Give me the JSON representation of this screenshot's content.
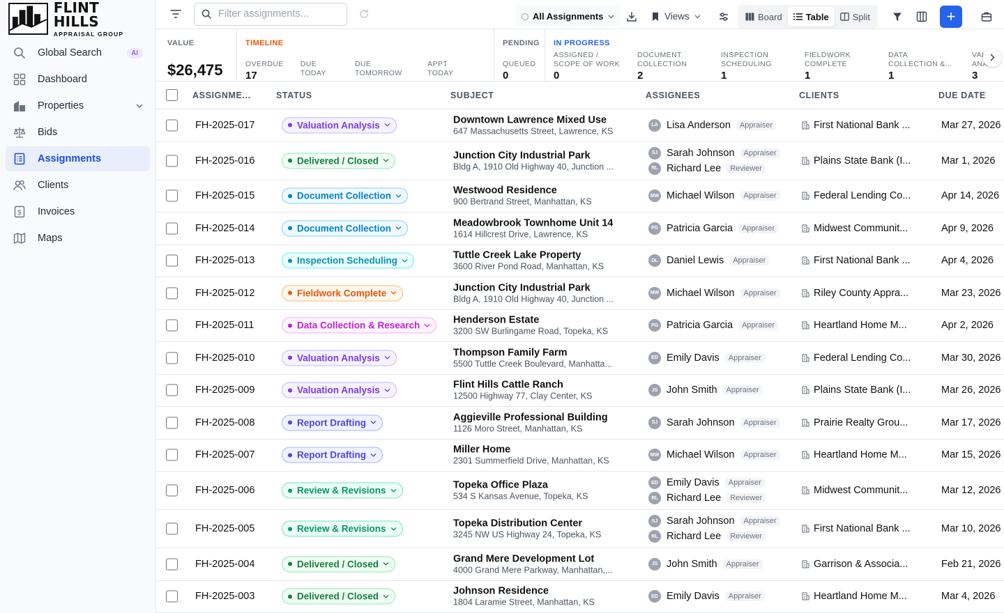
{
  "brand": {
    "line1": "FLINT HILLS",
    "line2": "APPRAISAL GROUP"
  },
  "sidebar": {
    "items": [
      {
        "label": "Global Search",
        "icon": "search-icon",
        "badge": "AI"
      },
      {
        "label": "Dashboard",
        "icon": "dashboard-icon"
      },
      {
        "label": "Properties",
        "icon": "building-icon",
        "chevron": true
      },
      {
        "label": "Bids",
        "icon": "scale-icon"
      },
      {
        "label": "Assignments",
        "icon": "clipboard-list-icon",
        "active": true
      },
      {
        "label": "Clients",
        "icon": "users-icon"
      },
      {
        "label": "Invoices",
        "icon": "invoice-icon"
      },
      {
        "label": "Maps",
        "icon": "map-icon"
      }
    ]
  },
  "toolbar": {
    "search_placeholder": "Filter assignments...",
    "filter_select": "All Assignments",
    "views_label": "Views",
    "board_label": "Board",
    "table_label": "Table",
    "split_label": "Split",
    "add_label": "+"
  },
  "stats": {
    "value_label": "VALUE",
    "value": "$26,475",
    "timeline_label": "TIMELINE",
    "timeline": [
      {
        "label": "OVERDUE",
        "value": "17"
      },
      {
        "label": "DUE TODAY",
        "value": "0"
      },
      {
        "label": "DUE TOMORROW",
        "value": "0"
      },
      {
        "label": "APPT TODAY",
        "value": "0"
      }
    ],
    "pending_label": "PENDING",
    "pending": [
      {
        "label": "QUEUED",
        "value": "0"
      }
    ],
    "inprogress_label": "IN PROGRESS",
    "inprogress": [
      {
        "label1": "ASSIGNED /",
        "label2": "SCOPE OF WORK",
        "value": "0"
      },
      {
        "label1": "DOCUMENT",
        "label2": "COLLECTION",
        "value": "2"
      },
      {
        "label1": "INSPECTION",
        "label2": "SCHEDULING",
        "value": "1"
      },
      {
        "label1": "FIELDWORK",
        "label2": "COMPLETE",
        "value": "1"
      },
      {
        "label1": "DATA",
        "label2": "COLLECTION &...",
        "value": "1"
      },
      {
        "label1": "VAL",
        "label2": "ANA",
        "value": "3"
      }
    ]
  },
  "table": {
    "headers": {
      "assignment": "ASSIGNME...",
      "status": "STATUS",
      "subject": "SUBJECT",
      "assignees": "ASSIGNEES",
      "clients": "CLIENTS",
      "due": "DUE DATE"
    },
    "status_colors": {
      "Valuation Analysis": {
        "fg": "#7c3aed",
        "bg": "#f5f3ff",
        "border": "#c4b5fd"
      },
      "Delivered / Closed": {
        "fg": "#15803d",
        "bg": "#f0fdf4",
        "border": "#86efac"
      },
      "Document Collection": {
        "fg": "#0284c7",
        "bg": "#f0f9ff",
        "border": "#7dd3fc"
      },
      "Inspection Scheduling": {
        "fg": "#0891b2",
        "bg": "#ecfeff",
        "border": "#67e8f9"
      },
      "Fieldwork Complete": {
        "fg": "#ea580c",
        "bg": "#fff7ed",
        "border": "#fdba74"
      },
      "Data Collection & Research": {
        "fg": "#c026d3",
        "bg": "#fdf4ff",
        "border": "#f0abfc"
      },
      "Report Drafting": {
        "fg": "#4f46e5",
        "bg": "#eef2ff",
        "border": "#a5b4fc"
      },
      "Review & Revisions": {
        "fg": "#059669",
        "bg": "#ecfdf5",
        "border": "#6ee7b7"
      }
    },
    "rows": [
      {
        "id": "FH-2025-017",
        "status": "Valuation Analysis",
        "title": "Downtown Lawrence Mixed Use",
        "address": "647 Massachusetts Street, Lawrence, KS",
        "assignees": [
          {
            "initials": "LA",
            "name": "Lisa Anderson",
            "role": "Appraiser"
          }
        ],
        "client": "First National Bank ...",
        "due": "Mar 27, 2026"
      },
      {
        "id": "FH-2025-016",
        "status": "Delivered / Closed",
        "title": "Junction City Industrial Park",
        "address": "Bldg A, 1910 Old Highway 40, Junction ...",
        "assignees": [
          {
            "initials": "SJ",
            "name": "Sarah Johnson",
            "role": "Appraiser"
          },
          {
            "initials": "RL",
            "name": "Richard Lee",
            "role": "Reviewer"
          }
        ],
        "client": "Plains State Bank (I...",
        "due": "Mar 1, 2026"
      },
      {
        "id": "FH-2025-015",
        "status": "Document Collection",
        "title": "Westwood Residence",
        "address": "900 Bertrand Street, Manhattan, KS",
        "assignees": [
          {
            "initials": "MW",
            "name": "Michael Wilson",
            "role": "Appraiser"
          }
        ],
        "client": "Federal Lending Co...",
        "due": "Apr 14, 2026"
      },
      {
        "id": "FH-2025-014",
        "status": "Document Collection",
        "title": "Meadowbrook Townhome Unit 14",
        "address": "1614 Hillcrest Drive, Lawrence, KS",
        "assignees": [
          {
            "initials": "PG",
            "name": "Patricia Garcia",
            "role": "Appraiser"
          }
        ],
        "client": "Midwest Communit...",
        "due": "Apr 9, 2026"
      },
      {
        "id": "FH-2025-013",
        "status": "Inspection Scheduling",
        "title": "Tuttle Creek Lake Property",
        "address": "3600 River Pond Road, Manhattan, KS",
        "assignees": [
          {
            "initials": "DL",
            "name": "Daniel Lewis",
            "role": "Appraiser"
          }
        ],
        "client": "First National Bank ...",
        "due": "Apr 4, 2026"
      },
      {
        "id": "FH-2025-012",
        "status": "Fieldwork Complete",
        "title": "Junction City Industrial Park",
        "address": "Bldg A, 1910 Old Highway 40, Junction ...",
        "assignees": [
          {
            "initials": "MW",
            "name": "Michael Wilson",
            "role": "Appraiser"
          }
        ],
        "client": "Riley County Appra...",
        "due": "Mar 23, 2026"
      },
      {
        "id": "FH-2025-011",
        "status": "Data Collection & Research",
        "title": "Henderson Estate",
        "address": "3200 SW Burlingame Road, Topeka, KS",
        "assignees": [
          {
            "initials": "PG",
            "name": "Patricia Garcia",
            "role": "Appraiser"
          }
        ],
        "client": "Heartland Home M...",
        "due": "Apr 2, 2026"
      },
      {
        "id": "FH-2025-010",
        "status": "Valuation Analysis",
        "title": "Thompson Family Farm",
        "address": "5500 Tuttle Creek Boulevard, Manhatta...",
        "assignees": [
          {
            "initials": "ED",
            "name": "Emily Davis",
            "role": "Appraiser"
          }
        ],
        "client": "Federal Lending Co...",
        "due": "Mar 30, 2026"
      },
      {
        "id": "FH-2025-009",
        "status": "Valuation Analysis",
        "title": "Flint Hills Cattle Ranch",
        "address": "12500 Highway 77, Clay Center, KS",
        "assignees": [
          {
            "initials": "JS",
            "name": "John Smith",
            "role": "Appraiser"
          }
        ],
        "client": "Plains State Bank (I...",
        "due": "Mar 26, 2026"
      },
      {
        "id": "FH-2025-008",
        "status": "Report Drafting",
        "title": "Aggieville Professional Building",
        "address": "1126 Moro Street, Manhattan, KS",
        "assignees": [
          {
            "initials": "SJ",
            "name": "Sarah Johnson",
            "role": "Appraiser"
          }
        ],
        "client": "Prairie Realty Grou...",
        "due": "Mar 17, 2026"
      },
      {
        "id": "FH-2025-007",
        "status": "Report Drafting",
        "title": "Miller Home",
        "address": "2301 Summerfield Drive, Manhattan, KS",
        "assignees": [
          {
            "initials": "MW",
            "name": "Michael Wilson",
            "role": "Appraiser"
          }
        ],
        "client": "Heartland Home M...",
        "due": "Mar 15, 2026"
      },
      {
        "id": "FH-2025-006",
        "status": "Review & Revisions",
        "title": "Topeka Office Plaza",
        "address": "534 S Kansas Avenue, Topeka, KS",
        "assignees": [
          {
            "initials": "ED",
            "name": "Emily Davis",
            "role": "Appraiser"
          },
          {
            "initials": "RL",
            "name": "Richard Lee",
            "role": "Reviewer"
          }
        ],
        "client": "Midwest Communit...",
        "due": "Mar 12, 2026"
      },
      {
        "id": "FH-2025-005",
        "status": "Review & Revisions",
        "title": "Topeka Distribution Center",
        "address": "3245 NW US Highway 24, Topeka, KS",
        "assignees": [
          {
            "initials": "SJ",
            "name": "Sarah Johnson",
            "role": "Appraiser"
          },
          {
            "initials": "RL",
            "name": "Richard Lee",
            "role": "Reviewer"
          }
        ],
        "client": "First National Bank ...",
        "due": "Mar 10, 2026"
      },
      {
        "id": "FH-2025-004",
        "status": "Delivered / Closed",
        "title": "Grand Mere Development Lot",
        "address": "4000 Grand Mere Parkway, Manhattan,...",
        "assignees": [
          {
            "initials": "JS",
            "name": "John Smith",
            "role": "Appraiser"
          }
        ],
        "client": "Garrison & Associa...",
        "due": "Feb 21, 2026"
      },
      {
        "id": "FH-2025-003",
        "status": "Delivered / Closed",
        "title": "Johnson Residence",
        "address": "1804 Laramie Street, Manhattan, KS",
        "assignees": [
          {
            "initials": "ED",
            "name": "Emily Davis",
            "role": "Appraiser"
          }
        ],
        "client": "Heartland Home M...",
        "due": "Mar 4, 2026"
      }
    ]
  }
}
